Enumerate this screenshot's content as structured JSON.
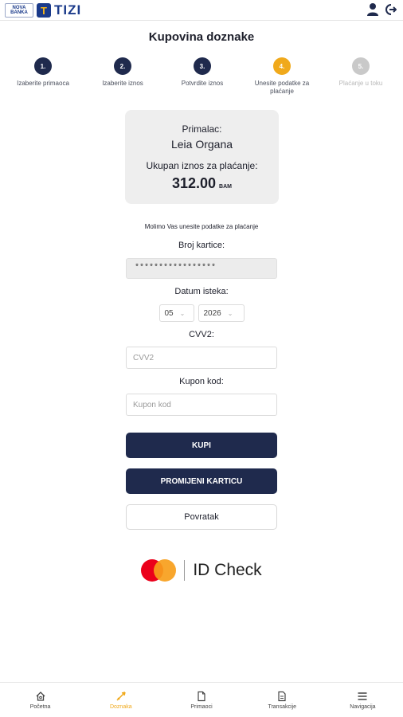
{
  "header": {
    "logo_small_text": "NOVA BANKA",
    "logo_brand_letter": "T",
    "logo_brand": "TIZI",
    "icons": [
      "user-icon",
      "logout-icon"
    ]
  },
  "page": {
    "title": "Kupovina doznake"
  },
  "steps": [
    {
      "number": "1.",
      "label": "Izaberite primaoca",
      "state": "done"
    },
    {
      "number": "2.",
      "label": "Izaberite iznos",
      "state": "done"
    },
    {
      "number": "3.",
      "label": "Potvrdite iznos",
      "state": "done"
    },
    {
      "number": "4.",
      "label": "Unesite podatke za plaćanje",
      "state": "active"
    },
    {
      "number": "5.",
      "label": "Plaćanje u toku",
      "state": "future"
    }
  ],
  "summary": {
    "recipient_label": "Primalac:",
    "recipient_name": "Leia Organa",
    "total_label": "Ukupan iznos za plaćanje:",
    "amount": "312.00",
    "currency": "BAM"
  },
  "form": {
    "instructions": "Molimo Vas unesite podatke za plaćanje",
    "card_label": "Broj kartice:",
    "card_value": "*****************",
    "expiry_label": "Datum isteka:",
    "expiry_month": "05",
    "expiry_year": "2026",
    "cvv_label": "CVV2:",
    "cvv_placeholder": "CVV2",
    "coupon_label": "Kupon kod:",
    "coupon_placeholder": "Kupon kod"
  },
  "buttons": {
    "buy": "KUPI",
    "change_card": "PROMIJENI KARTICU",
    "back": "Povratak"
  },
  "secure": {
    "text": "ID Check"
  },
  "nav": [
    {
      "label": "Početna",
      "icon": "home-icon",
      "active": false
    },
    {
      "label": "Doznaka",
      "icon": "send-icon",
      "active": true
    },
    {
      "label": "Primaoci",
      "icon": "document-icon",
      "active": false
    },
    {
      "label": "Transakcije",
      "icon": "transactions-icon",
      "active": false
    },
    {
      "label": "Navigacija",
      "icon": "menu-icon",
      "active": false
    }
  ],
  "colors": {
    "primary": "#1f2a4d",
    "accent": "#f0a91b",
    "mastercard_red": "#eb001b",
    "mastercard_yellow": "#f79e1b"
  }
}
